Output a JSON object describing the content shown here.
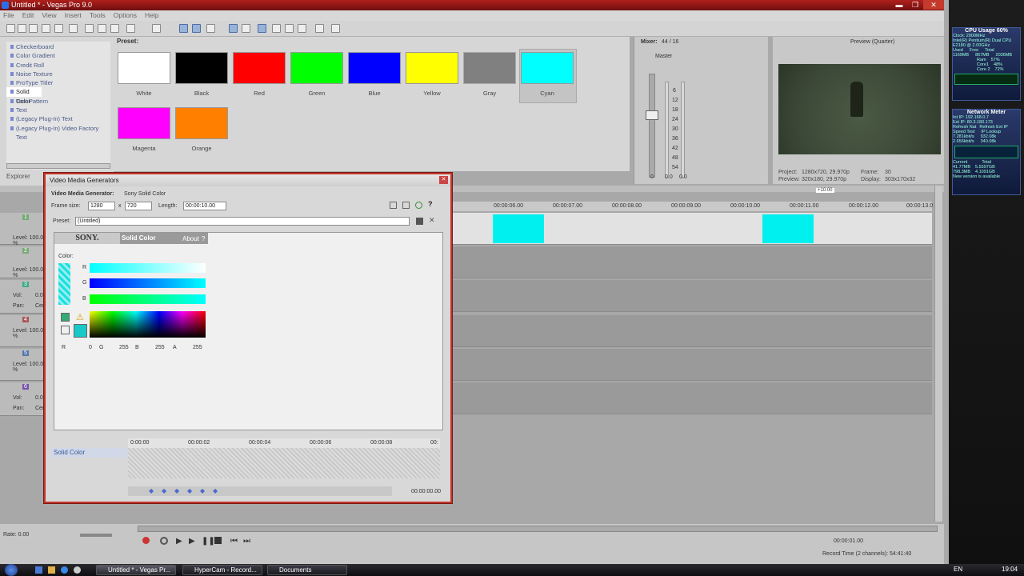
{
  "window": {
    "title": "Untitled * - Vegas Pro 9.0"
  },
  "menu": [
    "File",
    "Edit",
    "View",
    "Insert",
    "Tools",
    "Options",
    "Help"
  ],
  "generators": [
    "Checkerboard",
    "Color Gradient",
    "Credit Roll",
    "Noise Texture",
    "ProType Titler",
    "Solid Color",
    "Test Pattern",
    "Text",
    "(Legacy Plug-In) Text",
    "(Legacy Plug-In) Video Factory Text"
  ],
  "explorer_tab": "Explorer",
  "preset_label": "Preset:",
  "presets": [
    {
      "name": "White",
      "color": "#ffffff"
    },
    {
      "name": "Black",
      "color": "#000000"
    },
    {
      "name": "Red",
      "color": "#ff0000"
    },
    {
      "name": "Green",
      "color": "#00ff00"
    },
    {
      "name": "Blue",
      "color": "#0000ff"
    },
    {
      "name": "Yellow",
      "color": "#ffff00"
    },
    {
      "name": "Gray",
      "color": "#808080"
    },
    {
      "name": "Cyan",
      "color": "#00ffff"
    },
    {
      "name": "Magenta",
      "color": "#ff00ff"
    },
    {
      "name": "Orange",
      "color": "#ff8000"
    }
  ],
  "mixer": {
    "label": "Mixer:",
    "count": "44 / 16",
    "master": "Master",
    "scale": [
      "6",
      "12",
      "18",
      "24",
      "30",
      "36",
      "42",
      "48",
      "54"
    ],
    "levels": [
      "0.0",
      "0.0"
    ],
    "zero": "0"
  },
  "preview": {
    "label": "Preview (Quarter)",
    "project": "Project:",
    "project_val": "1280x720, 29.970p",
    "preview_lbl": "Preview:",
    "preview_val": "320x180, 29.970p",
    "frame_lbl": "Frame:",
    "frame_val": "30",
    "display_lbl": "Display:",
    "display_val": "303x170x32"
  },
  "sidebar": {
    "cpu_title": "CPU Usage 60%",
    "cpu_lines": [
      "Clock: 2000MHz",
      "Intel(R) Pentium(R) Dual CPU",
      "E2180 @ 2.00GHz"
    ],
    "mem": [
      "Used",
      "Free",
      "Total",
      "1169MB",
      "867MB",
      "2036MB"
    ],
    "ram": "Ram",
    "ram_pct": "57%",
    "core1": "Core1",
    "core1_pct": "48%",
    "core2": "Core 2",
    "core2_pct": "72%",
    "net_title": "Network Meter",
    "net_lines": [
      "Int IP: 192.168.0.7",
      "Ext IP: 80.3.180.173",
      "Refresh Nat",
      "Refresh Ext IP",
      "Speed Test",
      "IP Lookup"
    ],
    "up_rate": "7.281kbit/s",
    "up_total": "932.08k",
    "down_rate": "2.656kbit/s",
    "down_total": "340.08k",
    "current": "Current",
    "total": "Total",
    "current_up": "41.77MB",
    "total_up": "5.5597GB",
    "current_down": "798.3MB",
    "total_down": "4.1091GB",
    "update": "New version is available"
  },
  "timeline": {
    "ruler": [
      "00:00:06.00",
      "00:00:07.00",
      "00:00:08.00",
      "00:00:09.00",
      "00:00:10.00",
      "00:00:11.00",
      "00:00:12.00",
      "00:00:13.0"
    ],
    "marker": "+10.00",
    "tracks": [
      {
        "num": "1",
        "line": "Level: 100.0 %"
      },
      {
        "num": "2",
        "line": "Level: 100.0 %"
      },
      {
        "num": "3",
        "vol": "Vol:",
        "vol_val": "0.0",
        "pan": "Pan:",
        "pan_val": "Center"
      },
      {
        "num": "4",
        "line": "Level: 100.0 %"
      },
      {
        "num": "5",
        "line": "Level: 100.0 %"
      },
      {
        "num": "6",
        "vol": "Vol:",
        "vol_val": "0.0",
        "pan": "Pan:",
        "pan_val": "Center"
      }
    ]
  },
  "dialog": {
    "title": "Video Media Generators",
    "header_prefix": "Video Media Generator:",
    "header_value": "Sony Solid Color",
    "frame_size": "Frame size:",
    "width": "1280",
    "x": "x",
    "height": "720",
    "length_lbl": "Length:",
    "length": "00:00:10.00",
    "preset_lbl": "Preset:",
    "preset_val": "(Untitled)",
    "brand": "SONY.",
    "plugin": "Solid Color",
    "about": "About",
    "about_sym": "?",
    "color_lbl": "Color:",
    "r": "R",
    "g": "G",
    "b": "B",
    "a": "A",
    "r_val": "0",
    "g_val": "255",
    "b_val": "255",
    "a_val": "255",
    "times": [
      "0:00:00",
      "00:00:02",
      "00:00:04",
      "00:00:06",
      "00:00:08",
      "00:"
    ],
    "keyframe_row": "Solid Color",
    "end_time": "00:00:00.00"
  },
  "bottom": {
    "rate": "Rate: 0.00",
    "time": "00:00:01.00",
    "record": "Record Time (2 channels): 54:41:40"
  },
  "taskbar": {
    "items": [
      "Untitled * - Vegas Pr...",
      "HyperCam - Record...",
      "Documents"
    ],
    "lang": "EN",
    "clock": "19:04"
  }
}
